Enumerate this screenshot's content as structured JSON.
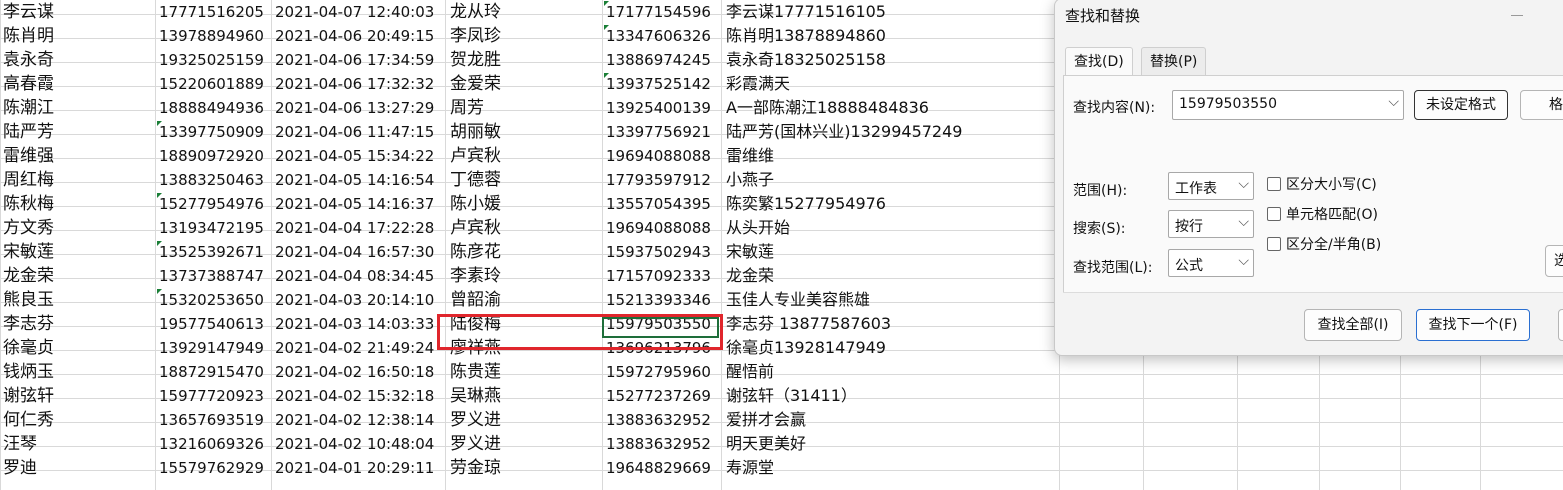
{
  "sheet": {
    "rows": [
      {
        "name": "李云谋",
        "phone1": "17771516205",
        "time": "2021-04-07 12:40:03",
        "person": "龙从玲",
        "phone2": "17177154596",
        "note": "李云谋17771516105",
        "t1": false,
        "t4": true
      },
      {
        "name": "陈肖明",
        "phone1": "13978894960",
        "time": "2021-04-06 20:49:15",
        "person": "李凤珍",
        "phone2": "13347606326",
        "note": "陈肖明13878894860",
        "t1": false,
        "t4": true
      },
      {
        "name": "袁永奇",
        "phone1": "19325025159",
        "time": "2021-04-06 17:34:59",
        "person": "贺龙胜",
        "phone2": "13886974245",
        "note": "袁永奇18325025158",
        "t1": false,
        "t4": false
      },
      {
        "name": "高春霞",
        "phone1": "15220601889",
        "time": "2021-04-06 17:32:32",
        "person": "金爱荣",
        "phone2": "13937525142",
        "note": "彩霞满天",
        "t1": false,
        "t4": true
      },
      {
        "name": "陈潮江",
        "phone1": "18888494936",
        "time": "2021-04-06 13:27:29",
        "person": "周芳",
        "phone2": "13925400139",
        "note": "A一部陈潮江18888484836",
        "t1": false,
        "t4": false
      },
      {
        "name": "陆严芳",
        "phone1": "13397750909",
        "time": "2021-04-06 11:47:15",
        "person": "胡丽敏",
        "phone2": "13397756921",
        "note": "陆严芳(国林兴业)13299457249",
        "t1": true,
        "t4": false
      },
      {
        "name": "雷维强",
        "phone1": "18890972920",
        "time": "2021-04-05 15:34:22",
        "person": "卢宾秋",
        "phone2": "19694088088",
        "note": "雷维维",
        "t1": false,
        "t4": false
      },
      {
        "name": "周红梅",
        "phone1": "13883250463",
        "time": "2021-04-05 14:16:54",
        "person": "丁德蓉",
        "phone2": "17793597912",
        "note": "小燕子",
        "t1": false,
        "t4": false
      },
      {
        "name": "陈秋梅",
        "phone1": "15277954976",
        "time": "2021-04-05 14:16:37",
        "person": "陈小媛",
        "phone2": "13557054395",
        "note": "陈奕繁15277954976",
        "t1": true,
        "t4": false
      },
      {
        "name": "方文秀",
        "phone1": "13193472195",
        "time": "2021-04-04 17:22:28",
        "person": "卢宾秋",
        "phone2": "19694088088",
        "note": "从头开始",
        "t1": false,
        "t4": false
      },
      {
        "name": "宋敏莲",
        "phone1": "13525392671",
        "time": "2021-04-04 16:57:30",
        "person": "陈彦花",
        "phone2": "15937502943",
        "note": "宋敏莲",
        "t1": true,
        "t4": false
      },
      {
        "name": "龙金荣",
        "phone1": "13737388747",
        "time": "2021-04-04 08:34:45",
        "person": "李素玲",
        "phone2": "17157092333",
        "note": "龙金荣",
        "t1": false,
        "t4": false
      },
      {
        "name": "熊良玉",
        "phone1": "15320253650",
        "time": "2021-04-03 20:14:10",
        "person": "曾韶渝",
        "phone2": "15213393346",
        "note": "玉佳人专业美容熊雄",
        "t1": true,
        "t4": false
      },
      {
        "name": "李志芬",
        "phone1": "19577540613",
        "time": "2021-04-03 14:03:33",
        "person": "陆俊梅",
        "phone2": "15979503550",
        "note": "李志芬 13877587603",
        "t1": false,
        "t4": false
      },
      {
        "name": "徐毫贞",
        "phone1": "13929147949",
        "time": "2021-04-02 21:49:24",
        "person": "廖祥燕",
        "phone2": "13696213796",
        "note": "徐毫贞13928147949",
        "t1": false,
        "t4": false
      },
      {
        "name": "钱炳玉",
        "phone1": "18872915470",
        "time": "2021-04-02 16:50:18",
        "person": "陈贵莲",
        "phone2": "15972795960",
        "note": "醒悟前",
        "t1": false,
        "t4": false
      },
      {
        "name": "谢弦轩",
        "phone1": "15977720923",
        "time": "2021-04-02 15:32:18",
        "person": "吴琳燕",
        "phone2": "15277237269",
        "note": "谢弦轩（31411）",
        "t1": false,
        "t4": false
      },
      {
        "name": "何仁秀",
        "phone1": "13657693519",
        "time": "2021-04-02 12:38:14",
        "person": "罗义进",
        "phone2": "13883632952",
        "note": "爱拼才会赢",
        "t1": false,
        "t4": false
      },
      {
        "name": "汪琴",
        "phone1": "13216069326",
        "time": "2021-04-02 10:48:04",
        "person": "罗义进",
        "phone2": "13883632952",
        "note": "明天更美好",
        "t1": false,
        "t4": false
      },
      {
        "name": "罗迪",
        "phone1": "15579762929",
        "time": "2021-04-01 20:29:11",
        "person": "劳金琼",
        "phone2": "19648829669",
        "note": "寿源堂",
        "t1": false,
        "t4": false
      }
    ]
  },
  "dialog": {
    "title": "查找和替换",
    "tab_find": "查找(D)",
    "tab_replace": "替换(P)",
    "find_label": "查找内容(N):",
    "find_value": "15979503550",
    "no_format_label": "未设定格式",
    "format_label": "格",
    "scope_label": "范围(H):",
    "scope_value": "工作表",
    "search_label": "搜索(S):",
    "search_value": "按行",
    "lookin_label": "查找范围(L):",
    "lookin_value": "公式",
    "match_case": "区分大小写(C)",
    "match_cell": "单元格匹配(O)",
    "match_width": "区分全/半角(B)",
    "options_label": "选",
    "find_all": "查找全部(I)",
    "find_next": "查找下一个(F)"
  }
}
